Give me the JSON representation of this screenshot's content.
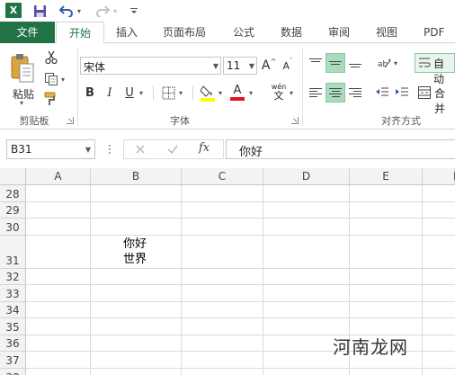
{
  "qat": {
    "app_letter": "X"
  },
  "tabs": [
    "文件",
    "开始",
    "插入",
    "页面布局",
    "公式",
    "数据",
    "审阅",
    "视图",
    "PDF工"
  ],
  "ribbon": {
    "clipboard": {
      "paste_label": "粘贴",
      "group_label": "剪贴板"
    },
    "font": {
      "font_name": "宋体",
      "font_size": "11",
      "grow_label": "A",
      "shrink_label": "A",
      "bold": "B",
      "italic": "I",
      "underline": "U",
      "font_color_label": "A",
      "phonetic_top": "wén",
      "phonetic_bottom": "文",
      "group_label": "字体"
    },
    "alignment": {
      "wrap_label": "自动",
      "merge_label": "合并",
      "group_label": "对齐方式"
    }
  },
  "formula_bar": {
    "name_box": "B31",
    "fx": "fx",
    "formula": "你好"
  },
  "grid": {
    "columns": [
      "A",
      "B",
      "C",
      "D",
      "E",
      "F"
    ],
    "rows": [
      "28",
      "29",
      "30",
      "31",
      "32",
      "33",
      "34",
      "35",
      "36",
      "37",
      "38"
    ],
    "cell_b31": {
      "line1": "你好",
      "line2": "世界"
    }
  },
  "watermark": "河南龙网",
  "colors": {
    "excel_green": "#217346",
    "selected_align": "#a9dcbe",
    "font_red": "#e81123",
    "highlight_yellow": "#ffff00"
  }
}
